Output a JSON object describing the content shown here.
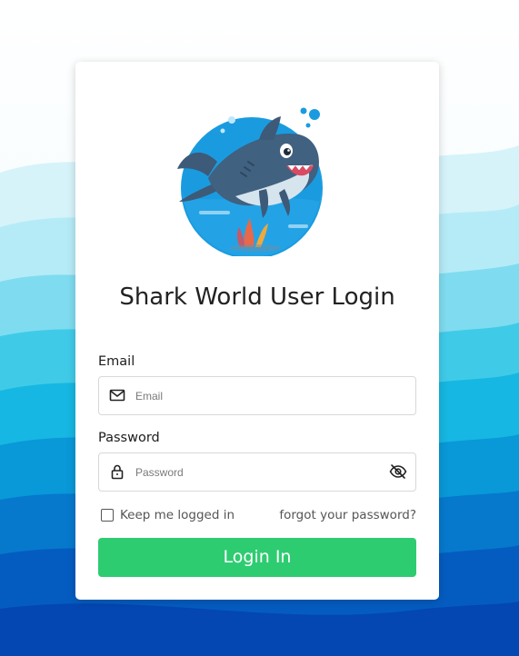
{
  "page": {
    "title": "Shark World User Login",
    "accent_color": "#2ecc71",
    "logo_icon": "shark-logo-icon"
  },
  "email": {
    "label": "Email",
    "placeholder": "Email",
    "value": "",
    "icon": "envelope-icon"
  },
  "password": {
    "label": "Password",
    "placeholder": "Password",
    "value": "",
    "icon": "lock-icon",
    "toggle_icon": "eye-slash-icon"
  },
  "remember": {
    "label": "Keep me logged in",
    "checked": false
  },
  "forgot_label": "forgot your password?",
  "login_label": "Login In"
}
